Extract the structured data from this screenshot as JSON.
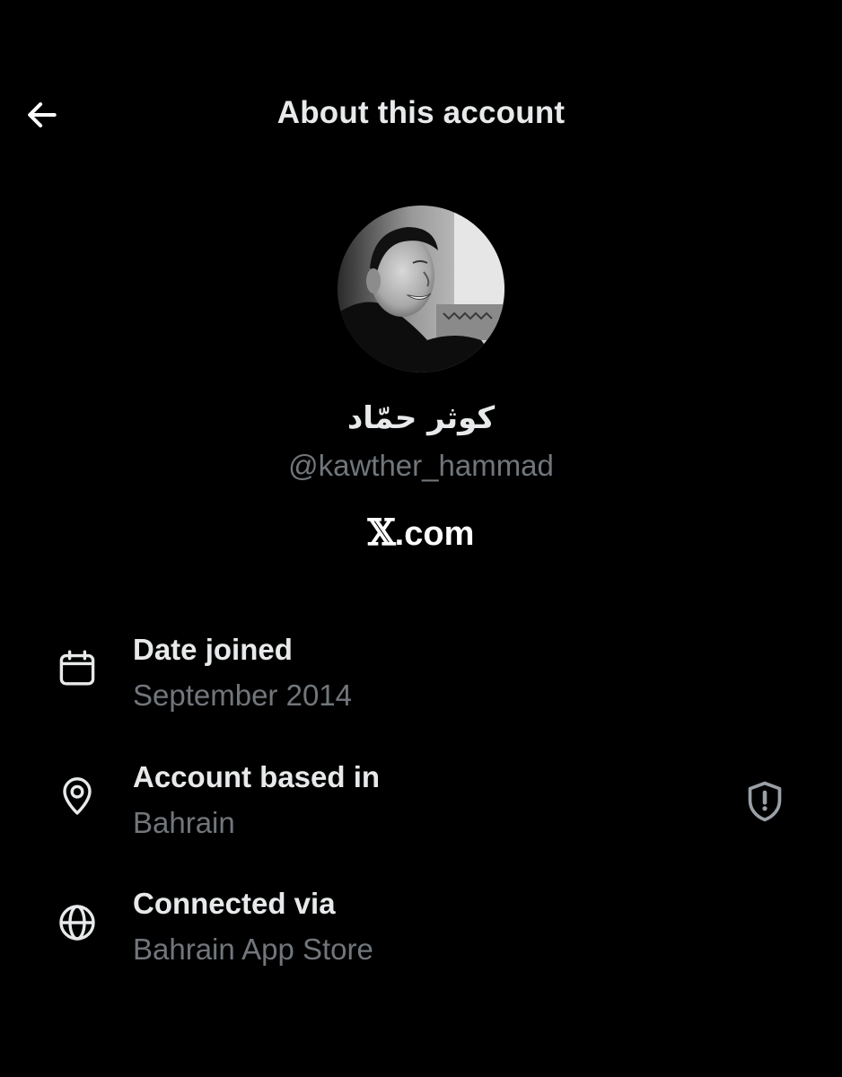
{
  "header": {
    "back_icon": "arrow-left-icon",
    "title": "About this account"
  },
  "profile": {
    "avatar_icon": "profile-photo",
    "display_name": "كوثر حمّاد",
    "handle": "@kawther_hammad",
    "brand_x": "𝕏",
    "brand_suffix": ".com"
  },
  "details": [
    {
      "icon": "calendar-icon",
      "label": "Date joined",
      "value": "September 2014"
    },
    {
      "icon": "location-pin-icon",
      "label": "Account based in",
      "value": "Bahrain",
      "badge_icon": "shield-alert-icon"
    },
    {
      "icon": "globe-icon",
      "label": "Connected via",
      "value": "Bahrain App Store"
    }
  ],
  "colors": {
    "background": "#000000",
    "primary_text": "#e7e9ea",
    "secondary_text": "#71767b"
  }
}
